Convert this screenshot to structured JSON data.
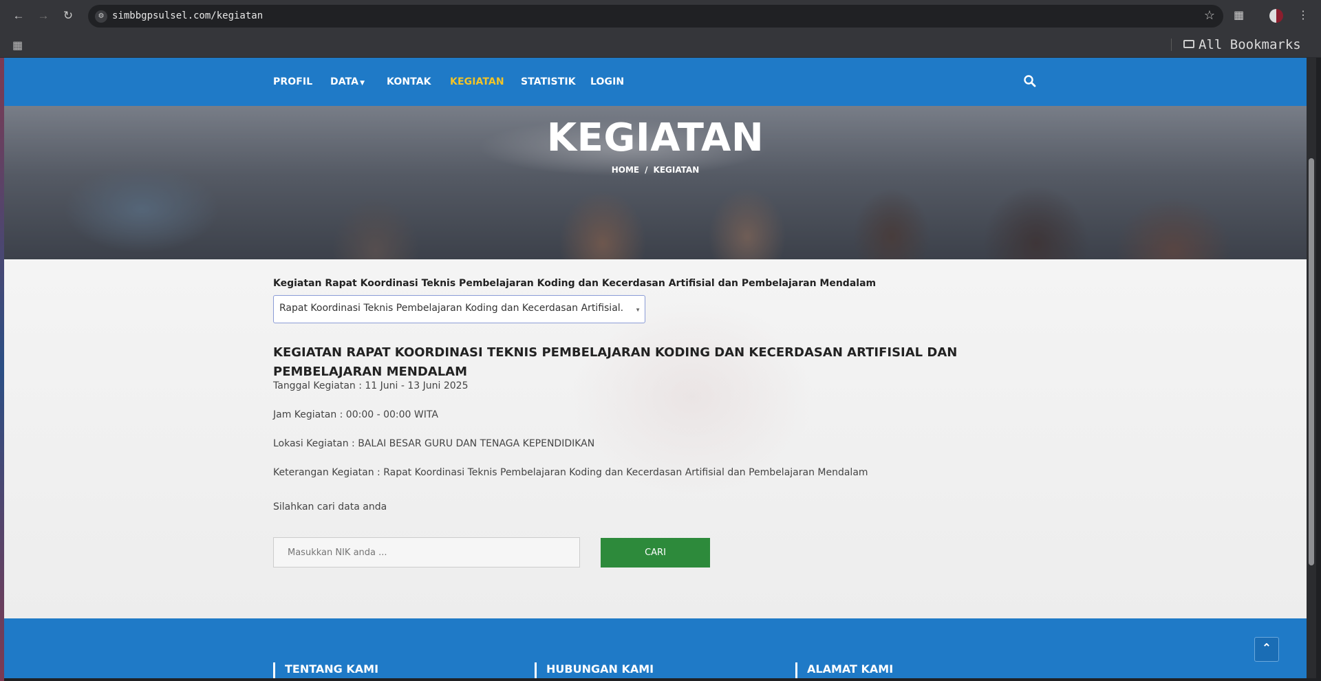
{
  "browser": {
    "url": "simbbgpsulsel.com/kegiatan",
    "bookmarks_label": "All Bookmarks"
  },
  "nav": {
    "items": [
      {
        "label": "PROFIL"
      },
      {
        "label": "DATA"
      },
      {
        "label": "KONTAK"
      },
      {
        "label": "KEGIATAN",
        "active": true
      },
      {
        "label": "STATISTIK"
      },
      {
        "label": "LOGIN"
      }
    ],
    "active_color": "#f2c428",
    "bar_color": "#1f7ac7"
  },
  "hero": {
    "title": "KEGIATAN",
    "breadcrumb_home": "HOME",
    "breadcrumb_separator": "/",
    "breadcrumb_current": "KEGIATAN"
  },
  "main": {
    "select_label": "Kegiatan Rapat Koordinasi Teknis Pembelajaran Koding dan Kecerdasan Artifisial dan Pembelajaran Mendalam",
    "select_value": "Rapat Koordinasi Teknis Pembelajaran Koding dan Kecerdasan Artifisial...",
    "heading": "KEGIATAN RAPAT KOORDINASI TEKNIS PEMBELAJARAN KODING DAN KECERDASAN ARTIFISIAL DAN PEMBELAJARAN MENDALAM",
    "tanggal": "Tanggal Kegiatan : 11 Juni - 13 Juni 2025",
    "jam": "Jam Kegiatan : 00:00 - 00:00 WITA",
    "lokasi": "Lokasi Kegiatan : BALAI BESAR GURU DAN TENAGA KEPENDIDIKAN",
    "keterangan": "Keterangan Kegiatan : Rapat Koordinasi Teknis Pembelajaran Koding dan Kecerdasan Artifisial dan Pembelajaran Mendalam",
    "search_prompt": "Silahkan cari data anda",
    "nik_placeholder": "Masukkan NIK anda ...",
    "search_button": "CARI",
    "button_color": "#2d8a3b"
  },
  "footer": {
    "columns": [
      "TENTANG KAMI",
      "HUBUNGAN KAMI",
      "ALAMAT KAMI"
    ]
  }
}
